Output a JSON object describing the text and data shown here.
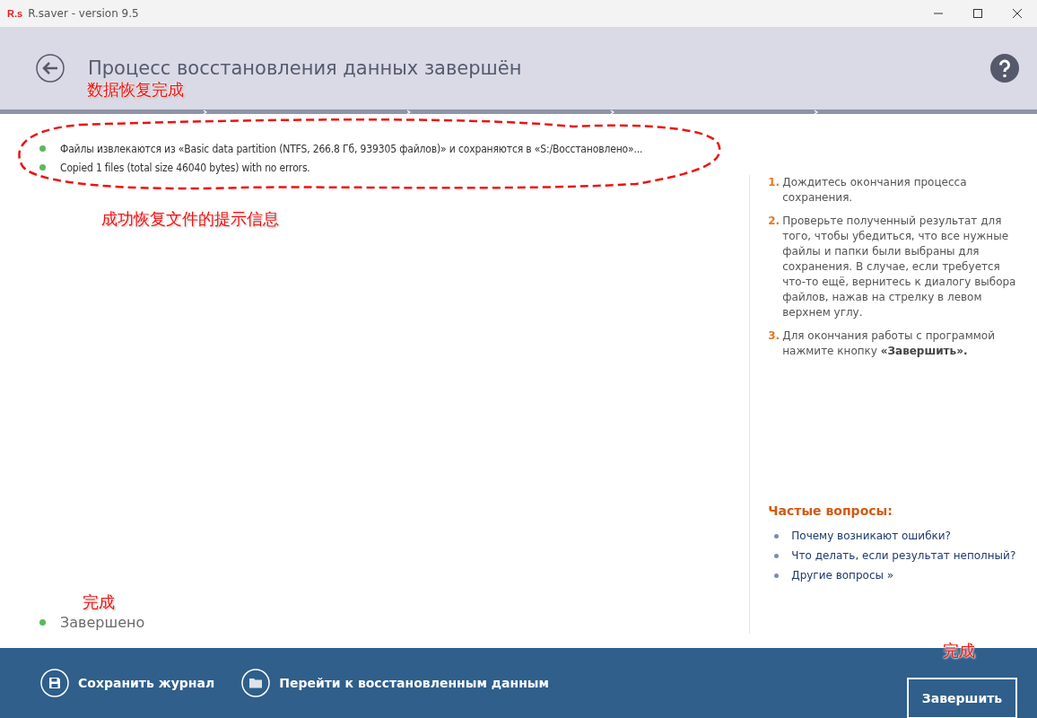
{
  "window": {
    "title": "R.saver - version 9.5",
    "logo": "R.s"
  },
  "header": {
    "title": "Процесс восстановления данных завершён"
  },
  "progress_steps": [
    {
      "done": true
    },
    {
      "done": true
    },
    {
      "done": true
    },
    {
      "done": true
    }
  ],
  "log": [
    {
      "text": "Файлы извлекаются из «Basic data partition (NTFS, 266.8 Гб, 939305 файлов)» и сохраняются в «S:/Восстановлено»...",
      "color": "#5cb85c"
    },
    {
      "text": "Copied 1 files (total size 46040 bytes) with no errors.",
      "color": "#5cb85c"
    }
  ],
  "status": {
    "text": "Завершено",
    "color": "#5cb85c"
  },
  "steps": [
    {
      "number": "1.",
      "text": "Дождитесь окончания процесса сохранения."
    },
    {
      "number": "2.",
      "text": "Проверьте полученный результат для того, чтобы убедиться, что все нужные файлы и папки были выбраны для сохранения. В случае, если требуется что-то ещё, вернитесь к диалогу выбора файлов, нажав на стрелку в левом верхнем углу."
    },
    {
      "number": "3.",
      "text": "Для окончания работы с программой нажмите кнопку **«Завершить».**"
    }
  ],
  "faq": {
    "title": "Частые вопросы:",
    "items": [
      "Почему возникают ошибки?",
      "Что делать, если результат неполный?",
      "Другие вопросы »"
    ]
  },
  "footer": {
    "buttons": [
      {
        "label": "Сохранить журнал",
        "kind": "save"
      },
      {
        "label": "Перейти к восстановленным данным",
        "kind": "folder"
      }
    ],
    "finish": "Завершить"
  },
  "annotations": [
    {
      "kind": "label",
      "text": "数据恢复完成"
    },
    {
      "kind": "ellipse"
    },
    {
      "kind": "label",
      "text": "成功恢复文件的提示信息"
    },
    {
      "kind": "label",
      "text": "完成"
    },
    {
      "kind": "label",
      "text": "完成"
    }
  ]
}
